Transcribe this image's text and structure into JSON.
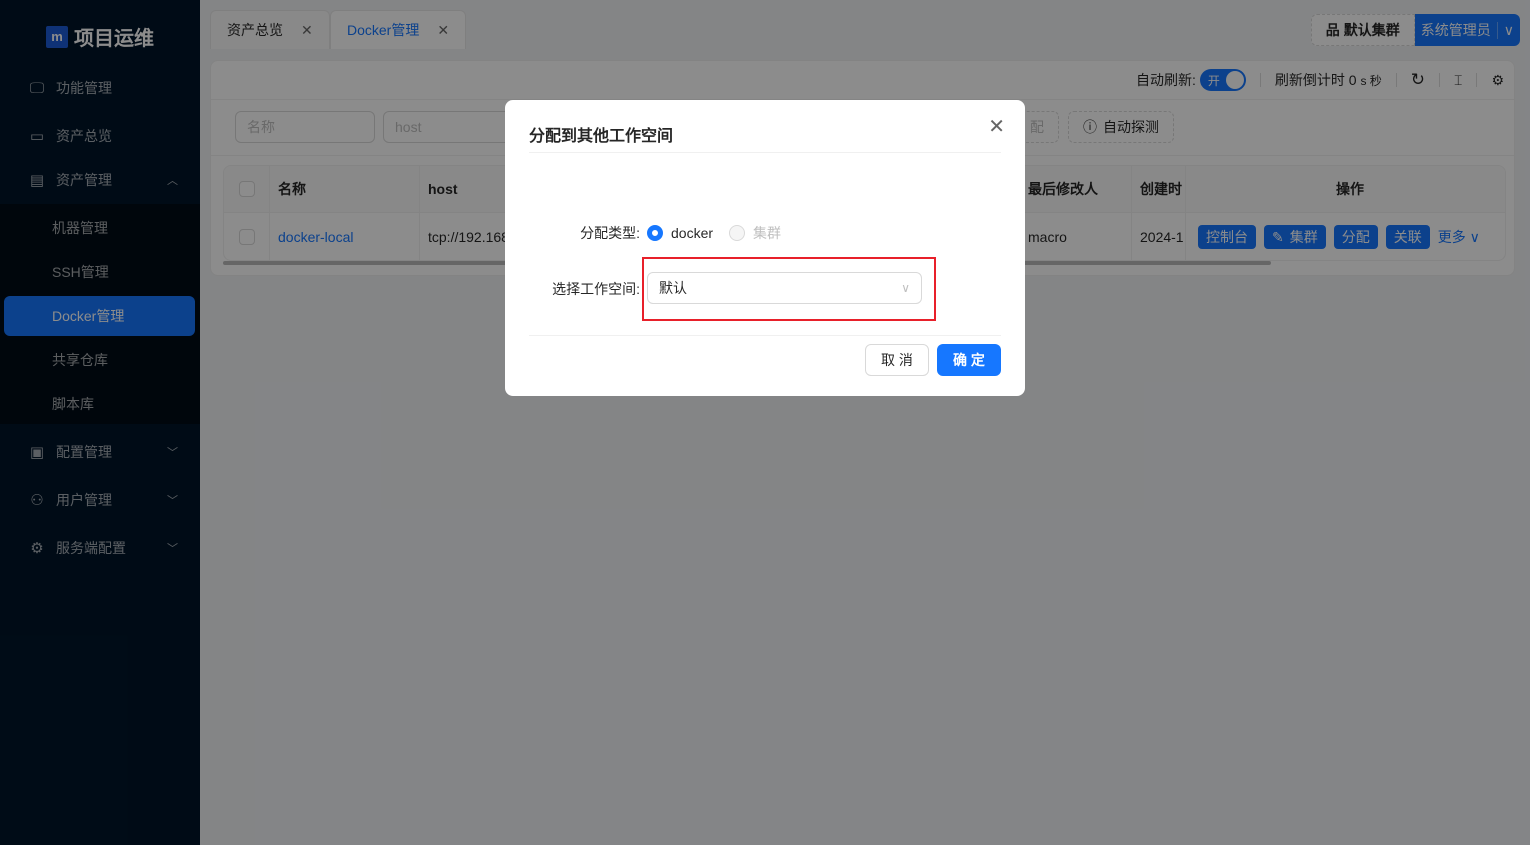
{
  "sidebar": {
    "logo_mark": "m",
    "logo_text": "项目运维",
    "items": [
      {
        "label": "功能管理",
        "icon": "desktop-icon"
      },
      {
        "label": "资产总览",
        "icon": "laptop-icon"
      },
      {
        "label": "资产管理",
        "icon": "database-icon"
      },
      {
        "label": "配置管理",
        "icon": "save-icon"
      },
      {
        "label": "用户管理",
        "icon": "user-icon"
      },
      {
        "label": "服务端配置",
        "icon": "setting-icon"
      }
    ],
    "subitems": [
      {
        "label": "机器管理"
      },
      {
        "label": "SSH管理"
      },
      {
        "label": "Docker管理",
        "active": true
      },
      {
        "label": "共享仓库"
      },
      {
        "label": "脚本库"
      }
    ]
  },
  "tabs": [
    {
      "label": "资产总览"
    },
    {
      "label": "Docker管理",
      "active": true
    }
  ],
  "header": {
    "cluster": "默认集群",
    "user": "系统管理员"
  },
  "toolbar": {
    "auto_refresh_label": "自动刷新:",
    "switch_text": "开",
    "countdown_label": "刷新倒计时",
    "countdown_value": "0",
    "countdown_unit": "s 秒"
  },
  "filters": {
    "name_placeholder": "名称",
    "host_placeholder": "host",
    "assign_partial": "配",
    "auto_detect": "自动探测"
  },
  "table": {
    "headers": [
      "名称",
      "host",
      "最后修改人",
      "创建时",
      "操作"
    ],
    "rows": [
      {
        "name": "docker-local",
        "host": "tcp://192.168",
        "modifier": "macro",
        "created": "2024-1"
      }
    ],
    "actions": [
      "控制台",
      "集群",
      "分配",
      "关联",
      "更多"
    ]
  },
  "modal": {
    "title": "分配到其他工作空间",
    "type_label": "分配类型:",
    "type_options": [
      "docker",
      "集群"
    ],
    "type_selected": "docker",
    "workspace_label": "选择工作空间:",
    "workspace_value": "默认",
    "cancel": "取 消",
    "ok": "确 定"
  },
  "colors": {
    "primary": "#1677ff",
    "sidebar": "#001529",
    "highlight": "#e8202a"
  }
}
